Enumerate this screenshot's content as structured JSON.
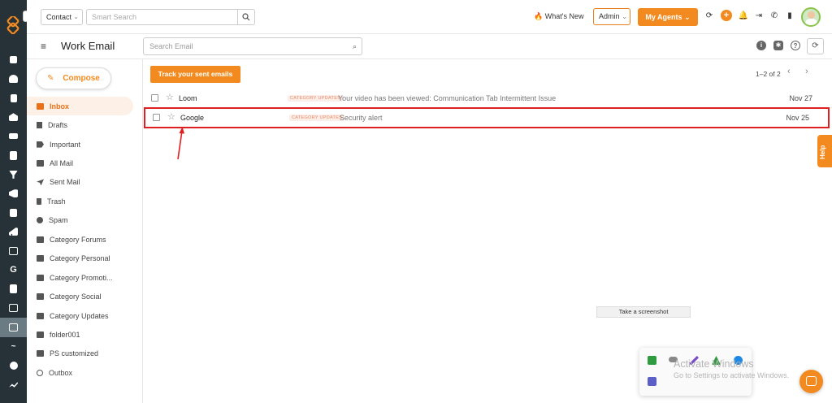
{
  "topbar": {
    "contact_select": "Contact",
    "smart_search_placeholder": "Smart Search",
    "whats_new": "What's New",
    "admin_select": "Admin",
    "my_agents": "My Agents"
  },
  "subbar": {
    "title": "Work Email",
    "search_placeholder": "Search Email"
  },
  "sidebar": {
    "compose": "Compose",
    "folders": [
      {
        "label": "Inbox",
        "icon": "inbox-icon"
      },
      {
        "label": "Drafts",
        "icon": "draft-icon"
      },
      {
        "label": "Important",
        "icon": "tag-icon"
      },
      {
        "label": "All Mail",
        "icon": "all-mail-icon"
      },
      {
        "label": "Sent Mail",
        "icon": "send-icon"
      },
      {
        "label": "Trash",
        "icon": "trash-icon"
      },
      {
        "label": "Spam",
        "icon": "spam-icon"
      },
      {
        "label": "Category Forums",
        "icon": "folder-icon"
      },
      {
        "label": "Category Personal",
        "icon": "folder-icon"
      },
      {
        "label": "Category Promoti...",
        "icon": "folder-icon"
      },
      {
        "label": "Category Social",
        "icon": "folder-icon"
      },
      {
        "label": "Category Updates",
        "icon": "folder-icon"
      },
      {
        "label": "folder001",
        "icon": "folder-icon"
      },
      {
        "label": "PS customized",
        "icon": "folder-icon"
      },
      {
        "label": "Outbox",
        "icon": "clock-icon"
      }
    ]
  },
  "main": {
    "track_button": "Track your sent emails",
    "pager": "1–2 of 2",
    "emails": [
      {
        "sender": "Loom",
        "badge": "CATEGORY UPDATES",
        "subject": "Your video has been viewed: Communication Tab Intermittent Issue",
        "date": "Nov 27"
      },
      {
        "sender": "Google",
        "badge": "CATEGORY UPDATES",
        "subject": "Security alert",
        "date": "Nov 25"
      }
    ]
  },
  "overlays": {
    "help": "Help",
    "screenshot_tip": "Take a screenshot",
    "activate_title": "Activate Windows",
    "activate_sub": "Go to Settings to activate Windows."
  },
  "colors": {
    "accent": "#f28a1f",
    "rail": "#263238",
    "highlight_box": "#e02020"
  }
}
